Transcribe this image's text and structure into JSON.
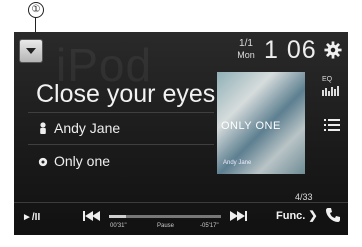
{
  "callout": {
    "number": "①"
  },
  "source": {
    "watermark": "iPod"
  },
  "header": {
    "track_count": "1/1",
    "day": "Mon",
    "time": "1 06"
  },
  "track": {
    "title": "Close your eyes",
    "artist": "Andy Jane",
    "album": "Only one"
  },
  "artwork": {
    "text": "ONLY ONE",
    "small_text": "Andy Jane"
  },
  "side": {
    "eq_label": "EQ"
  },
  "playlist": {
    "position": "4/33"
  },
  "controls": {
    "play_pause": "►/II",
    "elapsed": "00'31\"",
    "status": "Pause",
    "remaining": "-05'17\"",
    "func_label": "Func.",
    "progress_fraction": 0.15
  },
  "colors": {
    "screen_bg": "#1b1b1b",
    "text": "#f2f2f2",
    "accent": "#cfcfcf"
  },
  "icons": [
    "source-menu-icon",
    "gear-icon",
    "artist-icon",
    "album-icon",
    "eq-icon",
    "list-icon",
    "prev-track-icon",
    "next-track-icon",
    "phone-icon"
  ]
}
